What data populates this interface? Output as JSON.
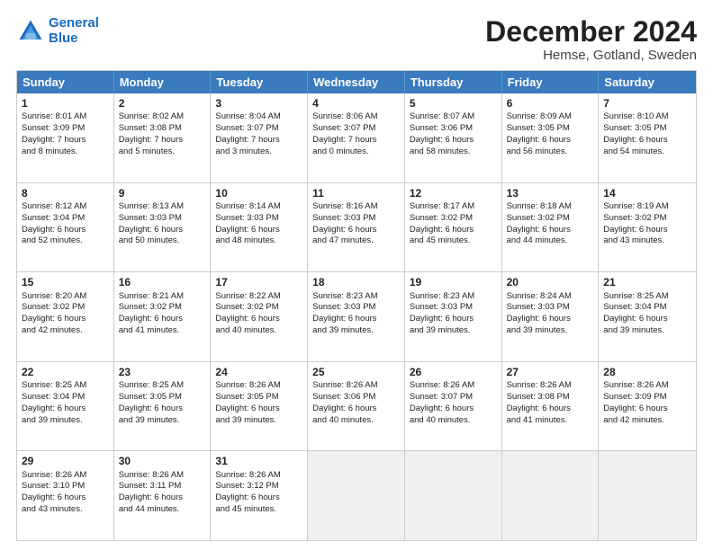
{
  "logo": {
    "line1": "General",
    "line2": "Blue"
  },
  "title": "December 2024",
  "subtitle": "Hemse, Gotland, Sweden",
  "header_days": [
    "Sunday",
    "Monday",
    "Tuesday",
    "Wednesday",
    "Thursday",
    "Friday",
    "Saturday"
  ],
  "rows": [
    [
      {
        "day": "1",
        "lines": [
          "Sunrise: 8:01 AM",
          "Sunset: 3:09 PM",
          "Daylight: 7 hours",
          "and 8 minutes."
        ]
      },
      {
        "day": "2",
        "lines": [
          "Sunrise: 8:02 AM",
          "Sunset: 3:08 PM",
          "Daylight: 7 hours",
          "and 5 minutes."
        ]
      },
      {
        "day": "3",
        "lines": [
          "Sunrise: 8:04 AM",
          "Sunset: 3:07 PM",
          "Daylight: 7 hours",
          "and 3 minutes."
        ]
      },
      {
        "day": "4",
        "lines": [
          "Sunrise: 8:06 AM",
          "Sunset: 3:07 PM",
          "Daylight: 7 hours",
          "and 0 minutes."
        ]
      },
      {
        "day": "5",
        "lines": [
          "Sunrise: 8:07 AM",
          "Sunset: 3:06 PM",
          "Daylight: 6 hours",
          "and 58 minutes."
        ]
      },
      {
        "day": "6",
        "lines": [
          "Sunrise: 8:09 AM",
          "Sunset: 3:05 PM",
          "Daylight: 6 hours",
          "and 56 minutes."
        ]
      },
      {
        "day": "7",
        "lines": [
          "Sunrise: 8:10 AM",
          "Sunset: 3:05 PM",
          "Daylight: 6 hours",
          "and 54 minutes."
        ]
      }
    ],
    [
      {
        "day": "8",
        "lines": [
          "Sunrise: 8:12 AM",
          "Sunset: 3:04 PM",
          "Daylight: 6 hours",
          "and 52 minutes."
        ]
      },
      {
        "day": "9",
        "lines": [
          "Sunrise: 8:13 AM",
          "Sunset: 3:03 PM",
          "Daylight: 6 hours",
          "and 50 minutes."
        ]
      },
      {
        "day": "10",
        "lines": [
          "Sunrise: 8:14 AM",
          "Sunset: 3:03 PM",
          "Daylight: 6 hours",
          "and 48 minutes."
        ]
      },
      {
        "day": "11",
        "lines": [
          "Sunrise: 8:16 AM",
          "Sunset: 3:03 PM",
          "Daylight: 6 hours",
          "and 47 minutes."
        ]
      },
      {
        "day": "12",
        "lines": [
          "Sunrise: 8:17 AM",
          "Sunset: 3:02 PM",
          "Daylight: 6 hours",
          "and 45 minutes."
        ]
      },
      {
        "day": "13",
        "lines": [
          "Sunrise: 8:18 AM",
          "Sunset: 3:02 PM",
          "Daylight: 6 hours",
          "and 44 minutes."
        ]
      },
      {
        "day": "14",
        "lines": [
          "Sunrise: 8:19 AM",
          "Sunset: 3:02 PM",
          "Daylight: 6 hours",
          "and 43 minutes."
        ]
      }
    ],
    [
      {
        "day": "15",
        "lines": [
          "Sunrise: 8:20 AM",
          "Sunset: 3:02 PM",
          "Daylight: 6 hours",
          "and 42 minutes."
        ]
      },
      {
        "day": "16",
        "lines": [
          "Sunrise: 8:21 AM",
          "Sunset: 3:02 PM",
          "Daylight: 6 hours",
          "and 41 minutes."
        ]
      },
      {
        "day": "17",
        "lines": [
          "Sunrise: 8:22 AM",
          "Sunset: 3:02 PM",
          "Daylight: 6 hours",
          "and 40 minutes."
        ]
      },
      {
        "day": "18",
        "lines": [
          "Sunrise: 8:23 AM",
          "Sunset: 3:03 PM",
          "Daylight: 6 hours",
          "and 39 minutes."
        ]
      },
      {
        "day": "19",
        "lines": [
          "Sunrise: 8:23 AM",
          "Sunset: 3:03 PM",
          "Daylight: 6 hours",
          "and 39 minutes."
        ]
      },
      {
        "day": "20",
        "lines": [
          "Sunrise: 8:24 AM",
          "Sunset: 3:03 PM",
          "Daylight: 6 hours",
          "and 39 minutes."
        ]
      },
      {
        "day": "21",
        "lines": [
          "Sunrise: 8:25 AM",
          "Sunset: 3:04 PM",
          "Daylight: 6 hours",
          "and 39 minutes."
        ]
      }
    ],
    [
      {
        "day": "22",
        "lines": [
          "Sunrise: 8:25 AM",
          "Sunset: 3:04 PM",
          "Daylight: 6 hours",
          "and 39 minutes."
        ]
      },
      {
        "day": "23",
        "lines": [
          "Sunrise: 8:25 AM",
          "Sunset: 3:05 PM",
          "Daylight: 6 hours",
          "and 39 minutes."
        ]
      },
      {
        "day": "24",
        "lines": [
          "Sunrise: 8:26 AM",
          "Sunset: 3:05 PM",
          "Daylight: 6 hours",
          "and 39 minutes."
        ]
      },
      {
        "day": "25",
        "lines": [
          "Sunrise: 8:26 AM",
          "Sunset: 3:06 PM",
          "Daylight: 6 hours",
          "and 40 minutes."
        ]
      },
      {
        "day": "26",
        "lines": [
          "Sunrise: 8:26 AM",
          "Sunset: 3:07 PM",
          "Daylight: 6 hours",
          "and 40 minutes."
        ]
      },
      {
        "day": "27",
        "lines": [
          "Sunrise: 8:26 AM",
          "Sunset: 3:08 PM",
          "Daylight: 6 hours",
          "and 41 minutes."
        ]
      },
      {
        "day": "28",
        "lines": [
          "Sunrise: 8:26 AM",
          "Sunset: 3:09 PM",
          "Daylight: 6 hours",
          "and 42 minutes."
        ]
      }
    ],
    [
      {
        "day": "29",
        "lines": [
          "Sunrise: 8:26 AM",
          "Sunset: 3:10 PM",
          "Daylight: 6 hours",
          "and 43 minutes."
        ]
      },
      {
        "day": "30",
        "lines": [
          "Sunrise: 8:26 AM",
          "Sunset: 3:11 PM",
          "Daylight: 6 hours",
          "and 44 minutes."
        ]
      },
      {
        "day": "31",
        "lines": [
          "Sunrise: 8:26 AM",
          "Sunset: 3:12 PM",
          "Daylight: 6 hours",
          "and 45 minutes."
        ]
      },
      {
        "day": "",
        "lines": [],
        "empty": true
      },
      {
        "day": "",
        "lines": [],
        "empty": true
      },
      {
        "day": "",
        "lines": [],
        "empty": true
      },
      {
        "day": "",
        "lines": [],
        "empty": true
      }
    ]
  ]
}
